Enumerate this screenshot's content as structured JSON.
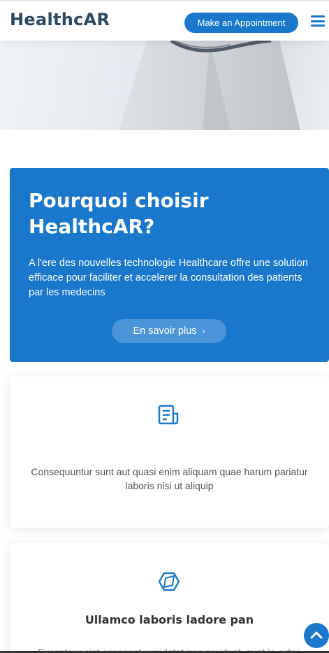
{
  "header": {
    "logo": "HealthcAR",
    "appointment_label": "Make an Appointment",
    "menu_icon": "hamburger-menu-icon"
  },
  "why": {
    "title": "Pourquoi choisir HealthcAR?",
    "text": "A l'ere des nouvelles technologie Healthcare offre une solution efficace pour faciliter et accelerer la consultation des patients par les medecins",
    "button_label": "En savoir plus",
    "button_icon": "chevron-right-icon"
  },
  "cards": [
    {
      "icon": "receipt-icon",
      "text": "Consequuntur sunt aut quasi enim aliquam quae harum pariatur laboris nisi ut aliquip"
    },
    {
      "icon": "cube-alt-icon",
      "title": "Ullamco laboris ladore pan",
      "text": "Excepteur sint occaecat cupidatat non proident, sunt in culpa"
    }
  ],
  "back_to_top_icon": "arrow-up-icon",
  "colors": {
    "accent": "#1977cc",
    "logo": "#2c4964",
    "text": "#444444"
  }
}
